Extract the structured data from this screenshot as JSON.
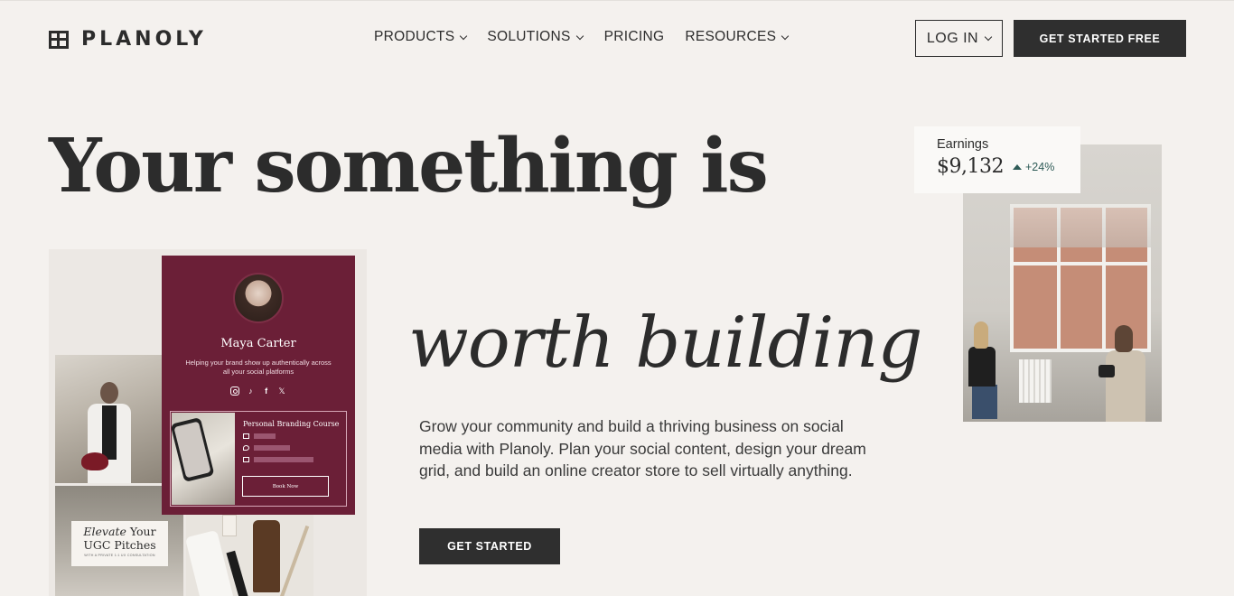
{
  "header": {
    "logo_text": "PLANOLY",
    "nav": [
      {
        "label": "PRODUCTS",
        "has_dropdown": true
      },
      {
        "label": "SOLUTIONS",
        "has_dropdown": true
      },
      {
        "label": "PRICING",
        "has_dropdown": false
      },
      {
        "label": "RESOURCES",
        "has_dropdown": true
      }
    ],
    "login_label": "LOG IN",
    "cta_label": "GET STARTED FREE"
  },
  "hero": {
    "headline_line1": "Your something is",
    "headline_line2": "worth building",
    "description": "Grow your community and build a thriving business on social media with Planoly. Plan your social content, design your dream grid, and build an online creator store to sell virtually anything.",
    "cta_label": "GET STARTED"
  },
  "collage": {
    "profile_name": "Maya Carter",
    "profile_tagline": "Helping your brand show up authentically across all your social platforms",
    "socials": [
      "instagram-icon",
      "tiktok-icon",
      "facebook-icon",
      "x-icon"
    ],
    "course_title": "Personal Branding Course",
    "book_label": "Book Now",
    "pitch_title_italic": "Elevate",
    "pitch_title_rest": "Your",
    "pitch_title_line2": "UGC Pitches",
    "pitch_subtitle": "WITH A PRIVATE 1:1 UX CONSULTATION"
  },
  "earnings": {
    "label": "Earnings",
    "value": "$9,132",
    "change": "+24%"
  },
  "colors": {
    "background": "#f4f1ee",
    "primary_button": "#2f2f2f",
    "profile_card": "#6b1f37",
    "positive_change": "#2e5b57"
  }
}
